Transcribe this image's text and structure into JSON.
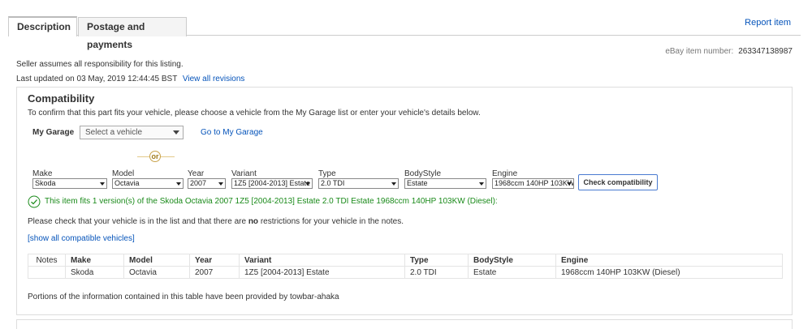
{
  "tabs": [
    {
      "label": "Description",
      "active": true
    },
    {
      "label": "Postage and payments",
      "active": false
    }
  ],
  "report_link": "Report item",
  "item_number": {
    "label": "eBay item number:",
    "value": "263347138987"
  },
  "seller_note": "Seller assumes all responsibility for this listing.",
  "last_updated": {
    "label": "Last updated on",
    "value": "03 May, 2019 12:44:45 BST",
    "link": "View all revisions"
  },
  "compatibility": {
    "title": "Compatibility",
    "intro": "To confirm that this part fits your vehicle, please choose a vehicle from the My Garage list or enter your vehicle's details below.",
    "garage": {
      "label": "My Garage",
      "placeholder": "Select a vehicle",
      "link": "Go to My Garage"
    },
    "or_text": "or",
    "fields": [
      {
        "label": "Make",
        "value": "Skoda"
      },
      {
        "label": "Model",
        "value": "Octavia"
      },
      {
        "label": "Year",
        "value": "2007"
      },
      {
        "label": "Variant",
        "value": "1Z5 [2004-2013] Estate"
      },
      {
        "label": "Type",
        "value": "2.0 TDI"
      },
      {
        "label": "BodyStyle",
        "value": "Estate"
      },
      {
        "label": "Engine",
        "value": "1968ccm 140HP 103KW (Diesel)"
      }
    ],
    "check_button": "Check compatibility",
    "fit_message": "This item fits 1 version(s) of the Skoda Octavia 2007 1Z5 [2004-2013] Estate 2.0 TDI Estate 1968ccm 140HP 103KW (Diesel):",
    "check_message": {
      "before": "Please check that your vehicle is in the list and that there are ",
      "bold": "no",
      "after": " restrictions for your vehicle in the notes."
    },
    "show_all": "[show all compatible vehicles]",
    "table": {
      "headers": [
        "Notes",
        "Make",
        "Model",
        "Year",
        "Variant",
        "Type",
        "BodyStyle",
        "Engine"
      ],
      "rows": [
        [
          "",
          "Skoda",
          "Octavia",
          "2007",
          "1Z5 [2004-2013] Estate",
          "2.0 TDI",
          "Estate",
          "1968ccm 140HP 103KW (Diesel)"
        ]
      ]
    },
    "portions_note": "Portions of the information contained in this table have been provided by towbar-ahaka"
  },
  "colors": {
    "link": "#0654ba",
    "success": "#1a8a1a",
    "or_accent": "#c9a24a",
    "button_border": "#4a7bd1"
  }
}
